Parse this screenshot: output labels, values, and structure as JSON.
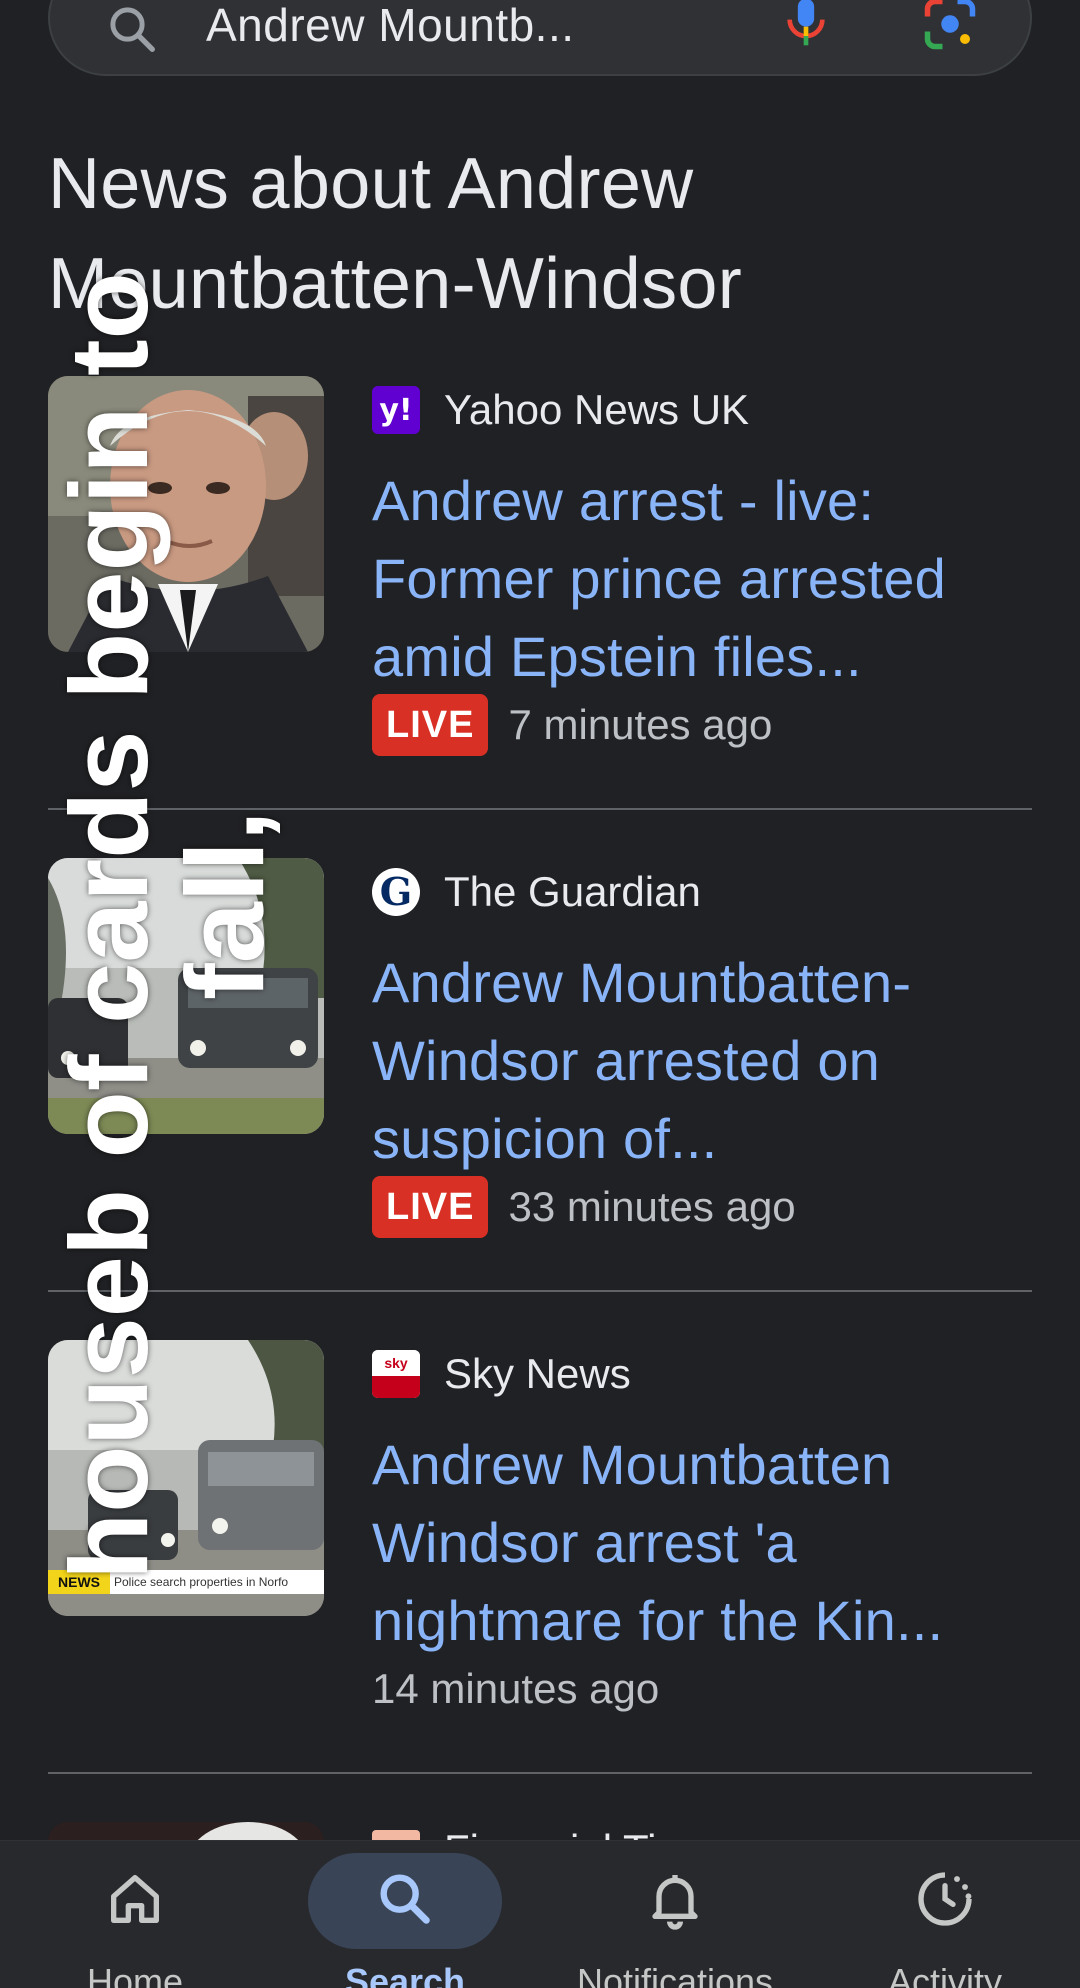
{
  "search": {
    "query": "Andrew Mountb..."
  },
  "section": {
    "title": "News about Andrew Mountbatten-Windsor"
  },
  "news": [
    {
      "source": "Yahoo News UK",
      "favicon": "yahoo-icon",
      "headline": "Andrew arrest - live: Former prince arrested amid Epstein files...",
      "live": "LIVE",
      "time": "7 minutes ago"
    },
    {
      "source": "The Guardian",
      "favicon": "guardian-icon",
      "headline": "Andrew Mountbatten-Windsor arrested on suspicion of...",
      "live": "LIVE",
      "time": "33 minutes ago"
    },
    {
      "source": "Sky News",
      "favicon": "sky-news-icon",
      "headline": "Andrew Mountbatten Windsor arrest 'a nightmare for the Kin...",
      "live": "",
      "time": "14 minutes ago",
      "thumb_ticker_brand": "NEWS",
      "thumb_ticker_text": "Police search properties in Norfo"
    }
  ],
  "partial_item": {
    "source": "Financial Ti"
  },
  "overlay": {
    "line1": "houseb of cards begin to",
    "line2": "fall,"
  },
  "nav": {
    "items": [
      {
        "label": "Home",
        "icon": "home-icon"
      },
      {
        "label": "Search",
        "icon": "search-icon"
      },
      {
        "label": "Notifications",
        "icon": "bell-icon"
      },
      {
        "label": "Activity",
        "icon": "activity-icon"
      }
    ],
    "active": "Search"
  },
  "colors": {
    "background": "#202124",
    "link": "#8ab4f8",
    "live": "#d93025",
    "nav_active_pill": "#394457"
  }
}
